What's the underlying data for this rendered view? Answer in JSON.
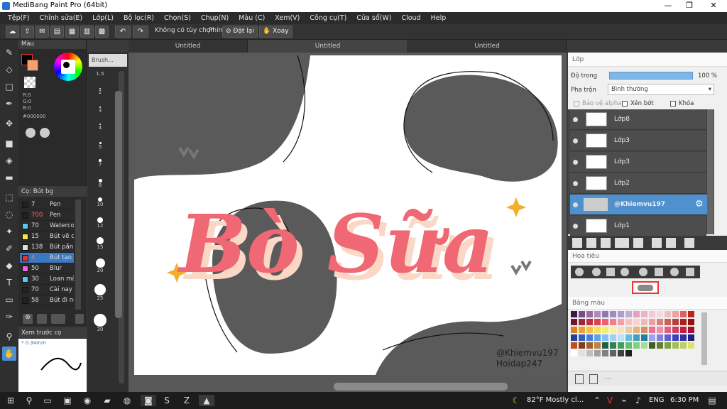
{
  "window": {
    "title": "MediBang Paint Pro (64bit)",
    "minimize": "—",
    "maximize": "❐",
    "close": "✕"
  },
  "menu": [
    "Tệp(F)",
    "Chỉnh sửa(E)",
    "Lớp(L)",
    "Bộ lọc(R)",
    "Chọn(S)",
    "Chụp(N)",
    "Màu (C)",
    "Xem(V)",
    "Công cụ(T)",
    "Cửa sổ(W)",
    "Cloud",
    "Help"
  ],
  "toolbar": {
    "no_option": "Không có tùy chọn",
    "key_label": "Phím",
    "reset_label": "Đặt lại",
    "rotate_label": "Xoay"
  },
  "color_panel": {
    "title": "Màu",
    "r": "R:0",
    "g": "G:0",
    "b": "B:0",
    "hex": "#000000"
  },
  "brush_panel": {
    "title": "Cọ: Bút bg",
    "items": [
      {
        "size": "7",
        "name": "Pen",
        "color": "#222222"
      },
      {
        "size": "700",
        "name": "Pen",
        "color": "#222222"
      },
      {
        "size": "70",
        "name": "Waterco",
        "color": "#55c8f5"
      },
      {
        "size": "15",
        "name": "Bút vẽ c",
        "color": "#f5e442"
      },
      {
        "size": "138",
        "name": "Bút pần",
        "color": "#dddddd"
      },
      {
        "size": "4",
        "name": "Bút tạo",
        "color": "#e53333"
      },
      {
        "size": "50",
        "name": "Blur",
        "color": "#e56ad8"
      },
      {
        "size": "30",
        "name": "Loan mà",
        "color": "#55c8f5"
      },
      {
        "size": "70",
        "name": "Cài nay c",
        "color": "#222222"
      },
      {
        "size": "58",
        "name": "Bút đi nể",
        "color": "#222222"
      }
    ]
  },
  "navigator": {
    "title": "Xem trước cọ",
    "size": "* 0.34mm"
  },
  "size_panel": {
    "title": "Brush...",
    "sizes": [
      "1.5",
      "2",
      "3",
      "4",
      "5",
      "7",
      "8",
      "10",
      "12",
      "15",
      "20",
      "25",
      "30"
    ]
  },
  "tabs": [
    "Untitled",
    "Untitled",
    "Untitled"
  ],
  "canvas": {
    "title": "Bò Sữa",
    "watermark1": "@Khiemvu197",
    "watermark2": "Hoidap247"
  },
  "layers_panel": {
    "title": "Lớp",
    "opacity_label": "Độ trong",
    "opacity_value": "100 %",
    "blend_label": "Pha trộn",
    "blend_value": "Bình thường",
    "protect_alpha": "Bảo vệ alpha",
    "clipping": "Xén bớt",
    "lock": "Khóa",
    "layers": [
      "Lớp8",
      "Lớp3",
      "Lớp3",
      "Lớp2",
      "@Khiemvu197",
      "Lớp1"
    ]
  },
  "navigator_panel": {
    "title": "Hoa tiêu"
  },
  "palette_panel": {
    "title": "Bảng màu",
    "more": "..."
  },
  "taskbar": {
    "weather": "82°F  Mostly cl...",
    "lang": "ENG",
    "time": "6:30 PM"
  }
}
